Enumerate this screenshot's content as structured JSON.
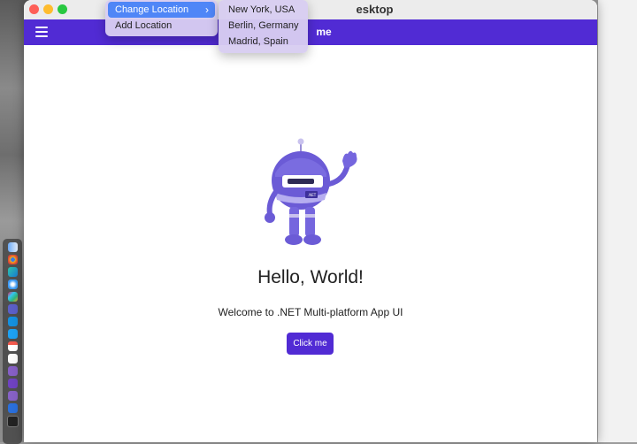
{
  "window": {
    "title": "esktop"
  },
  "appbar": {
    "title": "me"
  },
  "menu": {
    "items": [
      {
        "label": "Change Location",
        "chevron": "›"
      },
      {
        "label": "Add Location"
      }
    ],
    "submenu": [
      {
        "label": "New York, USA"
      },
      {
        "label": "Berlin, Germany"
      },
      {
        "label": "Madrid, Spain"
      }
    ]
  },
  "main": {
    "heading": "Hello, World!",
    "subtitle": "Welcome to .NET Multi-platform App UI",
    "button_label": "Click me"
  },
  "bot": {
    "badge": ".NET"
  },
  "colors": {
    "accent": "#512bd4",
    "menu_selected": "#4f86f7",
    "menu_bg": "#d7cdf0",
    "bot_purple": "#6b5bd6"
  },
  "dock": {
    "icons": [
      "finder-icon",
      "chrome-icon",
      "edge-icon",
      "safari-icon",
      "slack-icon",
      "teams-icon",
      "outlook-icon",
      "twitter-icon",
      "calendar-icon",
      "notes-icon",
      "visual-studio-icon",
      "vs-code-icon",
      "vs-icon",
      "azure-data-studio-icon",
      "terminal-icon"
    ]
  }
}
